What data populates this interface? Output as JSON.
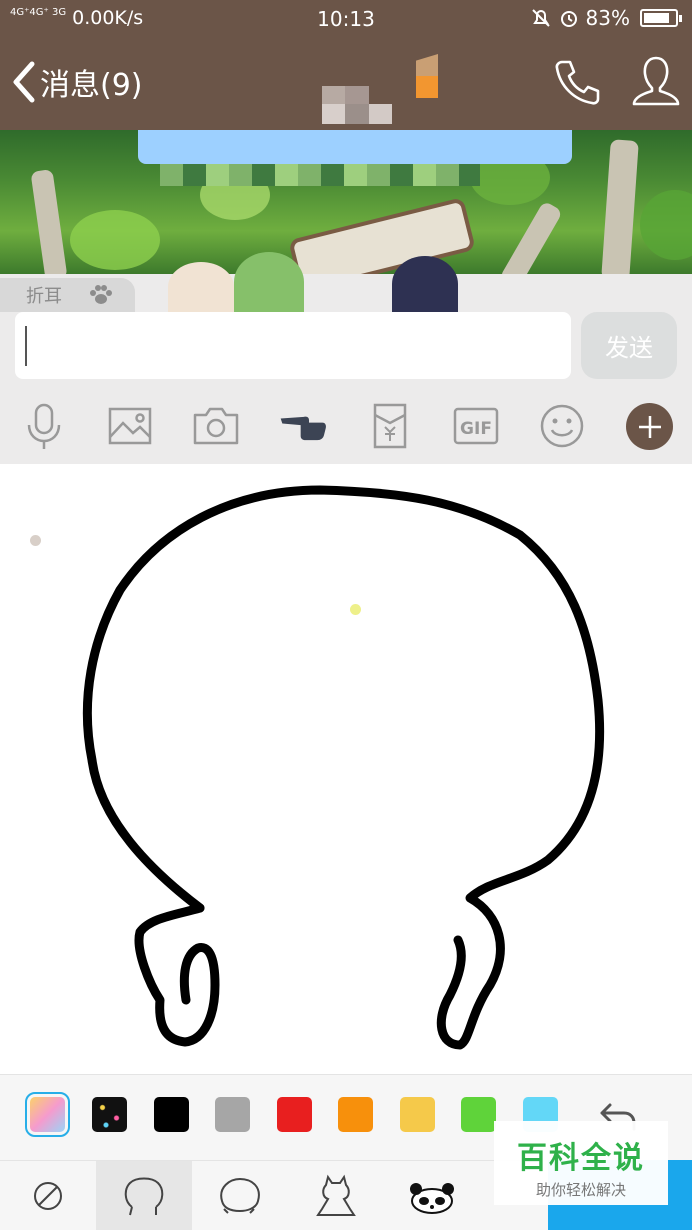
{
  "status_bar": {
    "network": "4G⁺4G⁺ 3G",
    "speed": "0.00K/s",
    "time": "10:13",
    "battery": "83%",
    "battery_level": 0.83
  },
  "nav": {
    "back_label": "消息(9)"
  },
  "panel": {
    "fold_label": "折耳",
    "send_label": "发送",
    "gif_label": "GIF",
    "message_input_value": ""
  },
  "toolbar_icons": [
    "microphone-icon",
    "image-icon",
    "camera-icon",
    "pointing-hand-icon",
    "red-packet-icon",
    "gif-icon",
    "smiley-icon",
    "plus-icon"
  ],
  "palette": {
    "colors": [
      "gradient",
      "sparkle",
      "#000000",
      "#a6a6a6",
      "#e81f1f",
      "#f7900c",
      "#f5c94a",
      "#5fd33a",
      "#63d7f7"
    ],
    "selected": "gradient"
  },
  "templates": [
    "none-icon",
    "bear-ears-outline-icon",
    "blob-outline-icon",
    "cat-outline-icon",
    "panda-icon"
  ],
  "watermark": {
    "title": "百科全说",
    "subtitle": "助你轻松解决"
  },
  "colors": {
    "header": "#6b5548",
    "panel_bg": "#ecebeb",
    "send_disabled": "#dcdede",
    "accent": "#1aa7ec"
  }
}
